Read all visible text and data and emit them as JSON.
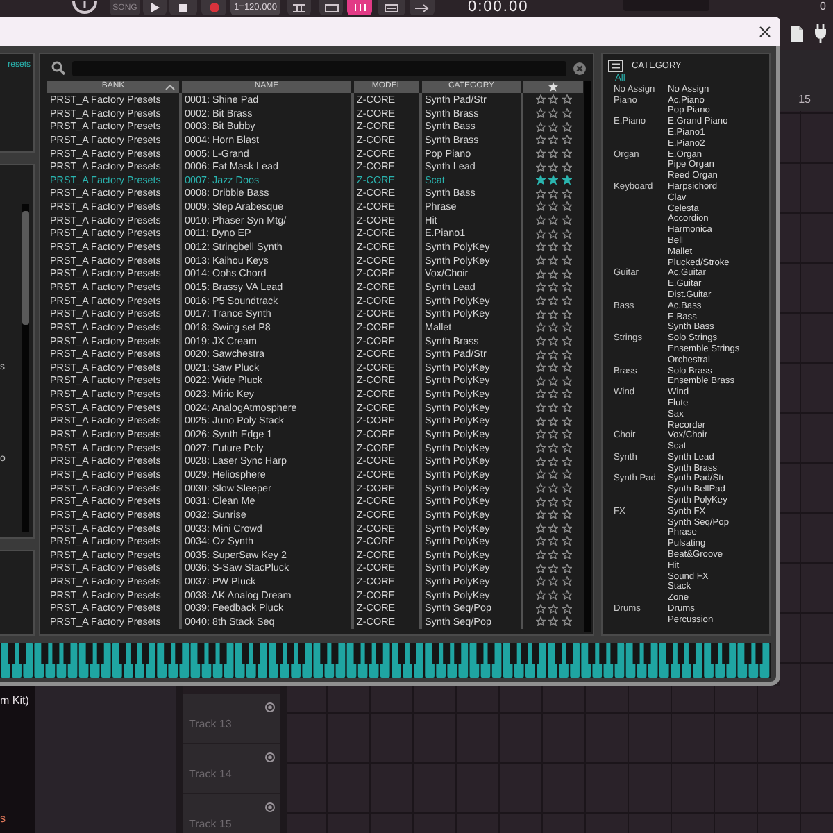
{
  "daw": {
    "toolbar": {
      "mode": "SONG",
      "tempo": "1=120.000",
      "time": "0:00.00",
      "counter": "0"
    },
    "ruler": {
      "marks": [
        "15"
      ]
    },
    "side_panel": {
      "text": "m Kit)",
      "note": "s"
    },
    "tracks": [
      {
        "name": "Track 13"
      },
      {
        "name": "Track 14"
      },
      {
        "name": "Track 15"
      }
    ]
  },
  "plugin": {
    "sidebar": {
      "title": "resets",
      "letters": [
        "s",
        "o"
      ]
    },
    "browser": {
      "columns": [
        {
          "kind": "text",
          "label": "BANK",
          "sorted": true
        },
        {
          "kind": "text",
          "label": "NAME",
          "sorted": false
        },
        {
          "kind": "text",
          "label": "MODEL",
          "sorted": false
        },
        {
          "kind": "text",
          "label": "CATEGORY",
          "sorted": false
        },
        {
          "kind": "rating",
          "sorted": false
        }
      ],
      "rows": [
        {
          "bank": "PRST_A Factory Presets",
          "name": "0001: Shine Pad",
          "model": "Z-CORE",
          "category": "Synth Pad/Str",
          "stars": 0,
          "selected": false
        },
        {
          "bank": "PRST_A Factory Presets",
          "name": "0002: Bit Brass",
          "model": "Z-CORE",
          "category": "Synth Brass",
          "stars": 0,
          "selected": false
        },
        {
          "bank": "PRST_A Factory Presets",
          "name": "0003: Bit Bubby",
          "model": "Z-CORE",
          "category": "Synth Bass",
          "stars": 0,
          "selected": false
        },
        {
          "bank": "PRST_A Factory Presets",
          "name": "0004: Horn Blast",
          "model": "Z-CORE",
          "category": "Synth Brass",
          "stars": 0,
          "selected": false
        },
        {
          "bank": "PRST_A Factory Presets",
          "name": "0005: L-Grand",
          "model": "Z-CORE",
          "category": "Pop Piano",
          "stars": 0,
          "selected": false
        },
        {
          "bank": "PRST_A Factory Presets",
          "name": "0006: Fat Mask Lead",
          "model": "Z-CORE",
          "category": "Synth Lead",
          "stars": 0,
          "selected": false
        },
        {
          "bank": "PRST_A Factory Presets",
          "name": "0007: Jazz Doos",
          "model": "Z-CORE",
          "category": "Scat",
          "stars": 3,
          "selected": true
        },
        {
          "bank": "PRST_A Factory Presets",
          "name": "0008: Dribble Bass",
          "model": "Z-CORE",
          "category": "Synth Bass",
          "stars": 0,
          "selected": false
        },
        {
          "bank": "PRST_A Factory Presets",
          "name": "0009: Step Arabesque",
          "model": "Z-CORE",
          "category": "Phrase",
          "stars": 0,
          "selected": false
        },
        {
          "bank": "PRST_A Factory Presets",
          "name": "0010: Phaser Syn Mtg/",
          "model": "Z-CORE",
          "category": "Hit",
          "stars": 0,
          "selected": false
        },
        {
          "bank": "PRST_A Factory Presets",
          "name": "0011: Dyno EP",
          "model": "Z-CORE",
          "category": "E.Piano1",
          "stars": 0,
          "selected": false
        },
        {
          "bank": "PRST_A Factory Presets",
          "name": "0012: Stringbell Synth",
          "model": "Z-CORE",
          "category": "Synth PolyKey",
          "stars": 0,
          "selected": false
        },
        {
          "bank": "PRST_A Factory Presets",
          "name": "0013: Kaihou Keys",
          "model": "Z-CORE",
          "category": "Synth PolyKey",
          "stars": 0,
          "selected": false
        },
        {
          "bank": "PRST_A Factory Presets",
          "name": "0014: Oohs Chord",
          "model": "Z-CORE",
          "category": "Vox/Choir",
          "stars": 0,
          "selected": false
        },
        {
          "bank": "PRST_A Factory Presets",
          "name": "0015: Brassy VA Lead",
          "model": "Z-CORE",
          "category": "Synth Lead",
          "stars": 0,
          "selected": false
        },
        {
          "bank": "PRST_A Factory Presets",
          "name": "0016: P5 Soundtrack",
          "model": "Z-CORE",
          "category": "Synth PolyKey",
          "stars": 0,
          "selected": false
        },
        {
          "bank": "PRST_A Factory Presets",
          "name": "0017: Trance Synth",
          "model": "Z-CORE",
          "category": "Synth PolyKey",
          "stars": 0,
          "selected": false
        },
        {
          "bank": "PRST_A Factory Presets",
          "name": "0018: Swing set P8",
          "model": "Z-CORE",
          "category": "Mallet",
          "stars": 0,
          "selected": false
        },
        {
          "bank": "PRST_A Factory Presets",
          "name": "0019: JX Cream",
          "model": "Z-CORE",
          "category": "Synth Brass",
          "stars": 0,
          "selected": false
        },
        {
          "bank": "PRST_A Factory Presets",
          "name": "0020: Sawchestra",
          "model": "Z-CORE",
          "category": "Synth Pad/Str",
          "stars": 0,
          "selected": false
        },
        {
          "bank": "PRST_A Factory Presets",
          "name": "0021: Saw Pluck",
          "model": "Z-CORE",
          "category": "Synth PolyKey",
          "stars": 0,
          "selected": false
        },
        {
          "bank": "PRST_A Factory Presets",
          "name": "0022: Wide Pluck",
          "model": "Z-CORE",
          "category": "Synth PolyKey",
          "stars": 0,
          "selected": false
        },
        {
          "bank": "PRST_A Factory Presets",
          "name": "0023: Mirio Key",
          "model": "Z-CORE",
          "category": "Synth PolyKey",
          "stars": 0,
          "selected": false
        },
        {
          "bank": "PRST_A Factory Presets",
          "name": "0024: AnalogAtmosphere",
          "model": "Z-CORE",
          "category": "Synth PolyKey",
          "stars": 0,
          "selected": false
        },
        {
          "bank": "PRST_A Factory Presets",
          "name": "0025: Juno Poly Stack",
          "model": "Z-CORE",
          "category": "Synth PolyKey",
          "stars": 0,
          "selected": false
        },
        {
          "bank": "PRST_A Factory Presets",
          "name": "0026: Synth Edge 1",
          "model": "Z-CORE",
          "category": "Synth PolyKey",
          "stars": 0,
          "selected": false
        },
        {
          "bank": "PRST_A Factory Presets",
          "name": "0027: Future Poly",
          "model": "Z-CORE",
          "category": "Synth PolyKey",
          "stars": 0,
          "selected": false
        },
        {
          "bank": "PRST_A Factory Presets",
          "name": "0028: Laser Sync Harp",
          "model": "Z-CORE",
          "category": "Synth PolyKey",
          "stars": 0,
          "selected": false
        },
        {
          "bank": "PRST_A Factory Presets",
          "name": "0029: Heliosphere",
          "model": "Z-CORE",
          "category": "Synth PolyKey",
          "stars": 0,
          "selected": false
        },
        {
          "bank": "PRST_A Factory Presets",
          "name": "0030: Slow Sleeper",
          "model": "Z-CORE",
          "category": "Synth PolyKey",
          "stars": 0,
          "selected": false
        },
        {
          "bank": "PRST_A Factory Presets",
          "name": "0031: Clean Me",
          "model": "Z-CORE",
          "category": "Synth PolyKey",
          "stars": 0,
          "selected": false
        },
        {
          "bank": "PRST_A Factory Presets",
          "name": "0032: Sunrise",
          "model": "Z-CORE",
          "category": "Synth PolyKey",
          "stars": 0,
          "selected": false
        },
        {
          "bank": "PRST_A Factory Presets",
          "name": "0033: Mini Crowd",
          "model": "Z-CORE",
          "category": "Synth PolyKey",
          "stars": 0,
          "selected": false
        },
        {
          "bank": "PRST_A Factory Presets",
          "name": "0034: Oz Synth",
          "model": "Z-CORE",
          "category": "Synth PolyKey",
          "stars": 0,
          "selected": false
        },
        {
          "bank": "PRST_A Factory Presets",
          "name": "0035: SuperSaw Key 2",
          "model": "Z-CORE",
          "category": "Synth PolyKey",
          "stars": 0,
          "selected": false
        },
        {
          "bank": "PRST_A Factory Presets",
          "name": "0036: S-Saw StacPluck",
          "model": "Z-CORE",
          "category": "Synth PolyKey",
          "stars": 0,
          "selected": false
        },
        {
          "bank": "PRST_A Factory Presets",
          "name": "0037: PW Pluck",
          "model": "Z-CORE",
          "category": "Synth PolyKey",
          "stars": 0,
          "selected": false
        },
        {
          "bank": "PRST_A Factory Presets",
          "name": "0038: AK Analog Dream",
          "model": "Z-CORE",
          "category": "Synth PolyKey",
          "stars": 0,
          "selected": false
        },
        {
          "bank": "PRST_A Factory Presets",
          "name": "0039: Feedback Pluck",
          "model": "Z-CORE",
          "category": "Synth Seq/Pop",
          "stars": 0,
          "selected": false
        },
        {
          "bank": "PRST_A Factory Presets",
          "name": "0040: 8th Stack Seq",
          "model": "Z-CORE",
          "category": "Synth Seq/Pop",
          "stars": 0,
          "selected": false
        }
      ]
    },
    "category_panel": {
      "title": "CATEGORY",
      "all": {
        "label": "All",
        "selected": true
      },
      "groups": [
        {
          "label": "No Assign",
          "selected": false,
          "items": [
            {
              "label": "No Assign",
              "selected": false
            }
          ]
        },
        {
          "label": "Piano",
          "selected": false,
          "items": [
            {
              "label": "Ac.Piano",
              "selected": false
            },
            {
              "label": "Pop Piano",
              "selected": false
            }
          ]
        },
        {
          "label": "E.Piano",
          "selected": false,
          "items": [
            {
              "label": "E.Grand Piano",
              "selected": false
            },
            {
              "label": "E.Piano1",
              "selected": false
            },
            {
              "label": "E.Piano2",
              "selected": false
            }
          ]
        },
        {
          "label": "Organ",
          "selected": false,
          "items": [
            {
              "label": "E.Organ",
              "selected": false
            },
            {
              "label": "Pipe Organ",
              "selected": false
            },
            {
              "label": "Reed Organ",
              "selected": false
            }
          ]
        },
        {
          "label": "Keyboard",
          "selected": false,
          "items": [
            {
              "label": "Harpsichord",
              "selected": false
            },
            {
              "label": "Clav",
              "selected": false
            },
            {
              "label": "Celesta",
              "selected": false
            },
            {
              "label": "Accordion",
              "selected": false
            },
            {
              "label": "Harmonica",
              "selected": false
            },
            {
              "label": "Bell",
              "selected": false
            },
            {
              "label": "Mallet",
              "selected": false
            },
            {
              "label": "Plucked/Stroke",
              "selected": false
            }
          ]
        },
        {
          "label": "Guitar",
          "selected": false,
          "items": [
            {
              "label": "Ac.Guitar",
              "selected": false
            },
            {
              "label": "E.Guitar",
              "selected": false
            },
            {
              "label": "Dist.Guitar",
              "selected": false
            }
          ]
        },
        {
          "label": "Bass",
          "selected": false,
          "items": [
            {
              "label": "Ac.Bass",
              "selected": false
            },
            {
              "label": "E.Bass",
              "selected": false
            },
            {
              "label": "Synth Bass",
              "selected": false
            }
          ]
        },
        {
          "label": "Strings",
          "selected": false,
          "items": [
            {
              "label": "Solo Strings",
              "selected": false
            },
            {
              "label": "Ensemble Strings",
              "selected": false
            },
            {
              "label": "Orchestral",
              "selected": false
            }
          ]
        },
        {
          "label": "Brass",
          "selected": false,
          "items": [
            {
              "label": "Solo Brass",
              "selected": false
            },
            {
              "label": "Ensemble Brass",
              "selected": false
            }
          ]
        },
        {
          "label": "Wind",
          "selected": false,
          "items": [
            {
              "label": "Wind",
              "selected": false
            },
            {
              "label": "Flute",
              "selected": false
            },
            {
              "label": "Sax",
              "selected": false
            },
            {
              "label": "Recorder",
              "selected": false
            }
          ]
        },
        {
          "label": "Choir",
          "selected": false,
          "items": [
            {
              "label": "Vox/Choir",
              "selected": false
            },
            {
              "label": "Scat",
              "selected": false
            }
          ]
        },
        {
          "label": "Synth",
          "selected": false,
          "items": [
            {
              "label": "Synth Lead",
              "selected": false
            },
            {
              "label": "Synth Brass",
              "selected": false
            }
          ]
        },
        {
          "label": "Synth Pad",
          "selected": false,
          "items": [
            {
              "label": "Synth Pad/Str",
              "selected": false
            },
            {
              "label": "Synth BellPad",
              "selected": false
            },
            {
              "label": "Synth PolyKey",
              "selected": false
            }
          ]
        },
        {
          "label": "FX",
          "selected": false,
          "items": [
            {
              "label": "Synth FX",
              "selected": false
            },
            {
              "label": "Synth Seq/Pop",
              "selected": false
            },
            {
              "label": "Phrase",
              "selected": false
            },
            {
              "label": "Pulsating",
              "selected": false
            },
            {
              "label": "Beat&Groove",
              "selected": false
            },
            {
              "label": "Hit",
              "selected": false
            },
            {
              "label": "Sound FX",
              "selected": false
            },
            {
              "label": "Stack",
              "selected": false
            },
            {
              "label": "Zone",
              "selected": false
            }
          ]
        },
        {
          "label": "Drums",
          "selected": false,
          "items": [
            {
              "label": "Drums",
              "selected": false
            },
            {
              "label": "Percussion",
              "selected": false
            }
          ]
        }
      ]
    }
  }
}
